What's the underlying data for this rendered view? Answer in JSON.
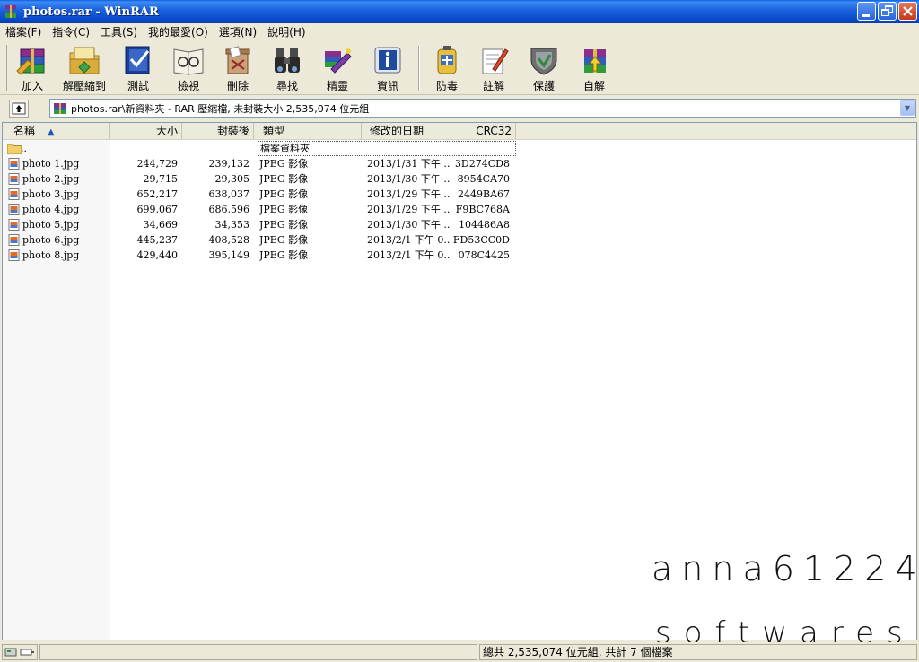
{
  "window": {
    "title": "photos.rar - WinRAR"
  },
  "menu": [
    "檔案(F)",
    "指令(C)",
    "工具(S)",
    "我的最愛(O)",
    "選項(N)",
    "說明(H)"
  ],
  "toolbar": [
    {
      "label": "加入",
      "icon": "add-archive-icon"
    },
    {
      "label": "解壓縮到",
      "icon": "extract-folder-icon"
    },
    {
      "label": "測試",
      "icon": "test-checkmark-icon"
    },
    {
      "label": "檢視",
      "icon": "view-glasses-icon"
    },
    {
      "label": "刪除",
      "icon": "delete-icon"
    },
    {
      "label": "尋找",
      "icon": "find-binoculars-icon"
    },
    {
      "label": "精靈",
      "icon": "wizard-icon"
    },
    {
      "label": "資訊",
      "icon": "info-icon"
    },
    {
      "label": "防毒",
      "icon": "antivirus-icon"
    },
    {
      "label": "註解",
      "icon": "comment-icon"
    },
    {
      "label": "保護",
      "icon": "protect-shield-icon"
    },
    {
      "label": "自解",
      "icon": "sfx-icon"
    }
  ],
  "address": {
    "path": "photos.rar\\新資料夾 - RAR 壓縮檔, 未封裝大小 2,535,074 位元組"
  },
  "columns": [
    "名稱",
    "大小",
    "封裝後",
    "類型",
    "修改的日期",
    "CRC32"
  ],
  "updir": {
    "name": "..",
    "type": "檔案資料夾"
  },
  "files": [
    {
      "name": "photo 1.jpg",
      "size": "244,729",
      "packed": "239,132",
      "type": "JPEG 影像",
      "modified": "2013/1/31 下午 ...",
      "crc": "3D274CD8"
    },
    {
      "name": "photo 2.jpg",
      "size": "29,715",
      "packed": "29,305",
      "type": "JPEG 影像",
      "modified": "2013/1/30 下午 ...",
      "crc": "8954CA70"
    },
    {
      "name": "photo 3.jpg",
      "size": "652,217",
      "packed": "638,037",
      "type": "JPEG 影像",
      "modified": "2013/1/29 下午 ...",
      "crc": "2449BA67"
    },
    {
      "name": "photo 4.jpg",
      "size": "699,067",
      "packed": "686,596",
      "type": "JPEG 影像",
      "modified": "2013/1/29 下午 ...",
      "crc": "F9BC768A"
    },
    {
      "name": "photo 5.jpg",
      "size": "34,669",
      "packed": "34,353",
      "type": "JPEG 影像",
      "modified": "2013/1/30 下午 ...",
      "crc": "104486A8"
    },
    {
      "name": "photo 6.jpg",
      "size": "445,237",
      "packed": "408,528",
      "type": "JPEG 影像",
      "modified": "2013/2/1 下午 0...",
      "crc": "FD53CC0D"
    },
    {
      "name": "photo 8.jpg",
      "size": "429,440",
      "packed": "395,149",
      "type": "JPEG 影像",
      "modified": "2013/2/1 下午 0...",
      "crc": "078C4425"
    }
  ],
  "watermark": {
    "line1": "anna61224",
    "line2": "softwares"
  },
  "status": {
    "summary": "總共 2,535,074 位元組, 共計 7 個檔案"
  }
}
